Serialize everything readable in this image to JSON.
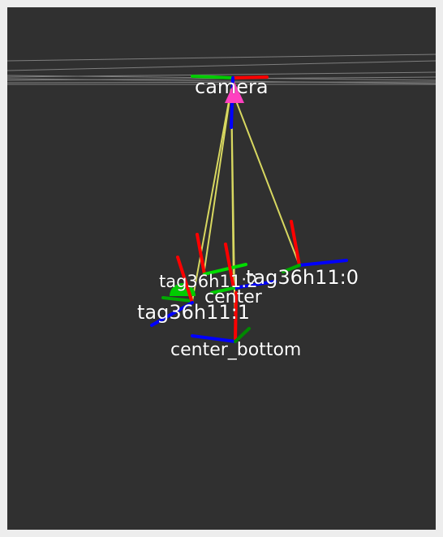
{
  "viewport": {
    "background_color": "#303030",
    "axis_colors": {
      "x": "#ff0000",
      "y": "#00cc00",
      "z": "#0000ff"
    },
    "link_color": "#d8d860",
    "camera_marker_color": "#ff40c0",
    "grid_color": "#a0a0a0"
  },
  "frames": {
    "camera": {
      "label": "camera"
    },
    "tag_2": {
      "label": "tag36h11:2"
    },
    "center": {
      "label": "center"
    },
    "tag_0": {
      "label": "tag36h11:0"
    },
    "tag_1": {
      "label": "tag36h11:1"
    },
    "center_bottom": {
      "label": "center_bottom"
    }
  }
}
